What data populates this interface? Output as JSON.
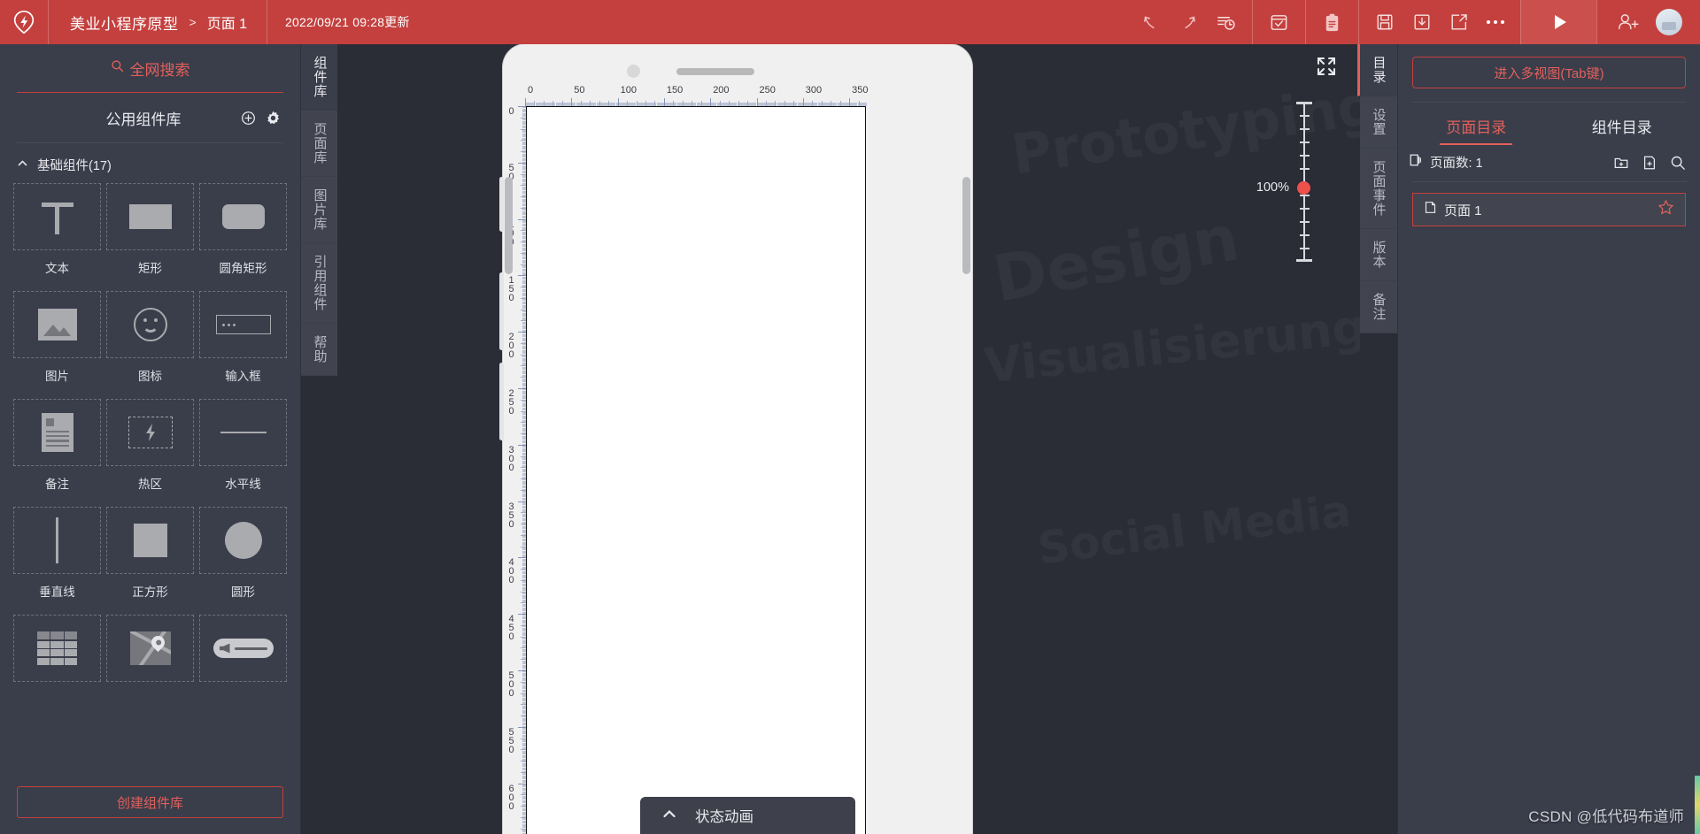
{
  "header": {
    "logo_icon": "lightning-location-logo",
    "project_name": "美业小程序原型",
    "breadcrumb_separator": ">",
    "page_name": "页面 1",
    "updated_time": "2022/09/21 09:28更新",
    "icons": [
      {
        "name": "undo-icon",
        "label": "撤销"
      },
      {
        "name": "redo-icon",
        "label": "重做"
      },
      {
        "name": "history-icon",
        "label": "历史记录"
      },
      {
        "name": "checkbox-review-icon",
        "label": "审阅"
      },
      {
        "name": "clipboard-icon",
        "label": "剪贴板"
      },
      {
        "name": "save-icon",
        "label": "保存"
      },
      {
        "name": "download-icon",
        "label": "下载"
      },
      {
        "name": "share-icon",
        "label": "分享"
      },
      {
        "name": "more-icon",
        "label": "更多"
      },
      {
        "name": "preview-play-icon",
        "label": "预览"
      },
      {
        "name": "add-user-icon",
        "label": "邀请协作"
      },
      {
        "name": "avatar",
        "label": "用户头像"
      }
    ]
  },
  "left_panel": {
    "search_label": "全网搜索",
    "search_icon": "search-icon",
    "library_title": "公用组件库",
    "add_icon": "plus-circle-icon",
    "settings_icon": "gear-icon",
    "group_title": "基础组件(17)",
    "collapse_icon": "chevron-up-icon",
    "components": [
      {
        "label": "文本",
        "icon": "text-icon"
      },
      {
        "label": "矩形",
        "icon": "rectangle-icon"
      },
      {
        "label": "圆角矩形",
        "icon": "rounded-rectangle-icon"
      },
      {
        "label": "图片",
        "icon": "image-icon"
      },
      {
        "label": "图标",
        "icon": "smiley-icon"
      },
      {
        "label": "输入框",
        "icon": "input-field-icon"
      },
      {
        "label": "备注",
        "icon": "note-icon"
      },
      {
        "label": "热区",
        "icon": "hotspot-icon"
      },
      {
        "label": "水平线",
        "icon": "horizontal-line-icon"
      },
      {
        "label": "垂直线",
        "icon": "vertical-line-icon"
      },
      {
        "label": "正方形",
        "icon": "square-icon"
      },
      {
        "label": "圆形",
        "icon": "circle-icon"
      },
      {
        "label": "表格",
        "icon": "table-icon"
      },
      {
        "label": "地图",
        "icon": "map-icon"
      },
      {
        "label": "滑块",
        "icon": "slider-icon"
      }
    ],
    "create_library_label": "创建组件库",
    "tabs": [
      {
        "label": "组件库",
        "active": true
      },
      {
        "label": "页面库",
        "active": false
      },
      {
        "label": "图片库",
        "active": false
      },
      {
        "label": "引用组件",
        "active": false
      },
      {
        "label": "帮助",
        "active": false
      }
    ]
  },
  "canvas": {
    "zoom_level": "100%",
    "expand_icon": "fullscreen-icon",
    "ruler_h_labels": [
      "0",
      "50",
      "100",
      "150",
      "200",
      "250",
      "300",
      "350"
    ],
    "ruler_v_labels": [
      "0",
      "50",
      "100",
      "150",
      "200",
      "250",
      "300",
      "350",
      "400",
      "450",
      "500",
      "550",
      "600"
    ],
    "status_bar_label": "状态动画",
    "status_bar_icon": "chevron-up-icon"
  },
  "right_panel": {
    "tabs": [
      {
        "label": "目录",
        "active": true
      },
      {
        "label": "设置",
        "active": false
      },
      {
        "label": "页面事件",
        "active": false
      },
      {
        "label": "版本",
        "active": false
      },
      {
        "label": "备注",
        "active": false
      }
    ],
    "multiview_button": "进入多视图(Tab键)",
    "content_tabs": [
      {
        "label": "页面目录",
        "active": true
      },
      {
        "label": "组件目录",
        "active": false
      }
    ],
    "page_count_label": "页面数: 1",
    "page_count_icon": "pages-icon",
    "actions": [
      {
        "name": "new-folder-icon"
      },
      {
        "name": "new-page-icon"
      },
      {
        "name": "search-icon"
      }
    ],
    "pages": [
      {
        "name": "页面 1",
        "icon": "page-icon",
        "starred": false,
        "selected": true
      }
    ]
  },
  "watermark": "CSDN @低代码布道师",
  "colors": {
    "brand_red": "#c4403e",
    "accent_red": "#e2605c",
    "panel_bg": "#3a3d4a",
    "canvas_bg": "#2a2c36",
    "tab_bg": "#41444f"
  }
}
